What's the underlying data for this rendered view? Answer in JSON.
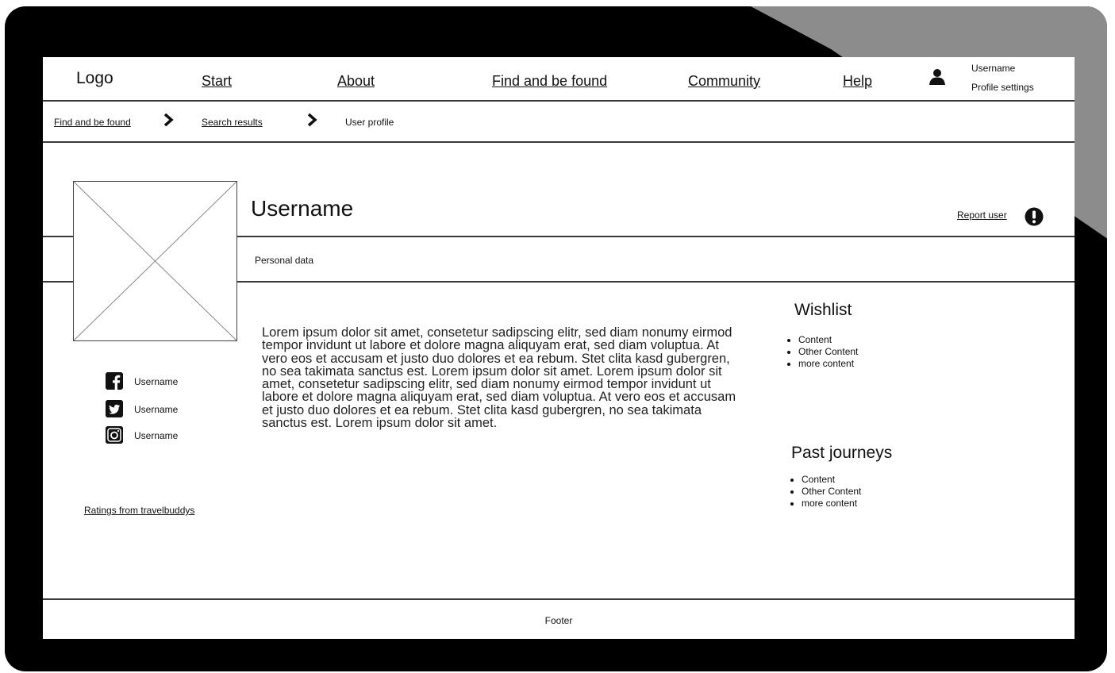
{
  "header": {
    "logo": "Logo",
    "nav": [
      "Start",
      "About",
      "Find and be found",
      "Community",
      "Help"
    ],
    "user_name": "Username",
    "profile_settings": "Profile settings",
    "user_icon": "user-icon"
  },
  "breadcrumb": {
    "items": [
      "Find and be found",
      "Search results",
      "User profile"
    ],
    "separator_icon": "chevron-right-icon"
  },
  "profile": {
    "username": "Username",
    "report_label": "Report user",
    "report_icon": "alert-icon",
    "personal_data_label": "Personal data",
    "avatar_icon": "image-placeholder-icon",
    "bio": "Lorem ipsum dolor sit amet, consetetur sadipscing elitr, sed diam nonumy eirmod tempor invidunt ut labore et dolore magna aliquyam erat, sed diam voluptua. At vero eos et accusam et justo duo dolores et ea rebum. Stet clita kasd gubergren, no sea takimata sanctus est. Lorem ipsum dolor sit amet. Lorem ipsum dolor sit amet, consetetur sadipscing elitr, sed diam nonumy eirmod tempor invidunt ut labore et dolore magna aliquyam erat, sed diam voluptua. At vero eos et accusam et justo duo dolores et ea rebum. Stet clita kasd gubergren, no sea takimata sanctus est. Lorem ipsum dolor sit amet."
  },
  "social": [
    {
      "icon": "facebook-icon",
      "name": "Username"
    },
    {
      "icon": "twitter-icon",
      "name": "Username"
    },
    {
      "icon": "instagram-icon",
      "name": "Username"
    }
  ],
  "ratings_label": "Ratings from travelbuddys",
  "wishlist": {
    "title": "Wishlist",
    "items": [
      "Content",
      "Other Content",
      "more content"
    ]
  },
  "past_journeys": {
    "title": "Past journeys",
    "items": [
      "Content",
      "Other Content",
      "more content"
    ]
  },
  "footer": "Footer",
  "colors": {
    "frame": "#000000",
    "screen": "#ffffff",
    "glare": "#8c8c8c",
    "line": "#3a3a3a"
  }
}
